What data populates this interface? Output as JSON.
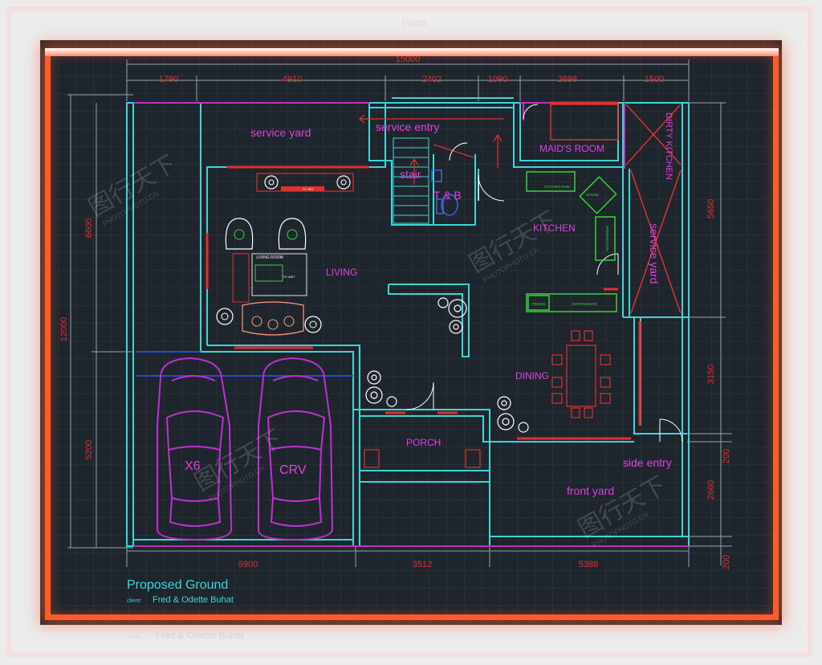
{
  "title_block": {
    "title": "Proposed Ground",
    "client_label": "client:",
    "client_name": "Fred & Odette Buhat"
  },
  "ghost_text": {
    "client_label": "client:",
    "client_name": "Fred & Odette Buhat",
    "top_dim": "15000"
  },
  "dimensions": {
    "overall_top": "15000",
    "top": [
      "1790",
      "4910",
      "2402",
      "1090",
      "2698",
      "1500"
    ],
    "bottom": [
      "5900",
      "3512",
      "5388"
    ],
    "left": [
      "6600",
      "12000",
      "5200"
    ],
    "right": [
      "5650",
      "3150",
      "200",
      "2660",
      "200"
    ]
  },
  "rooms": {
    "service_yard_top": "service yard",
    "service_entry": "service entry",
    "maids_room": "MAID'S ROOM",
    "dirty_kitchen": "DIRTY KITCHEN",
    "stair": "stair",
    "t_and_b": "T & B",
    "kitchen": "KITCHEN",
    "service_yard_right": "service yard",
    "living": "LIVING",
    "living_room_small": "LIVING ROOM",
    "dining": "DINING",
    "porch": "PORCH",
    "side_entry": "side entry",
    "front_yard": "front yard",
    "car_left": "X6",
    "car_right": "CRV"
  },
  "fixtures": {
    "range": "RANGE",
    "preparation": "PREPARATION",
    "fridge": "FRIDGE",
    "serving": "SERVING/WOK",
    "kitchen_sink": "KITCHEN SINK",
    "tv": "TV SET",
    "tv_unit": "TV UNIT"
  },
  "watermark": {
    "chinese": "图行天下",
    "latin": "PHOTOPHOTO.CN"
  },
  "colors": {
    "background": "#1f252d",
    "walls": "#39d7d7",
    "labels_magenta": "#e040e0",
    "dimension_red": "#e03030",
    "frame_glow": "#ff5a2e",
    "title_cyan": "#39d7d7",
    "green_fixture": "#34d43a"
  }
}
